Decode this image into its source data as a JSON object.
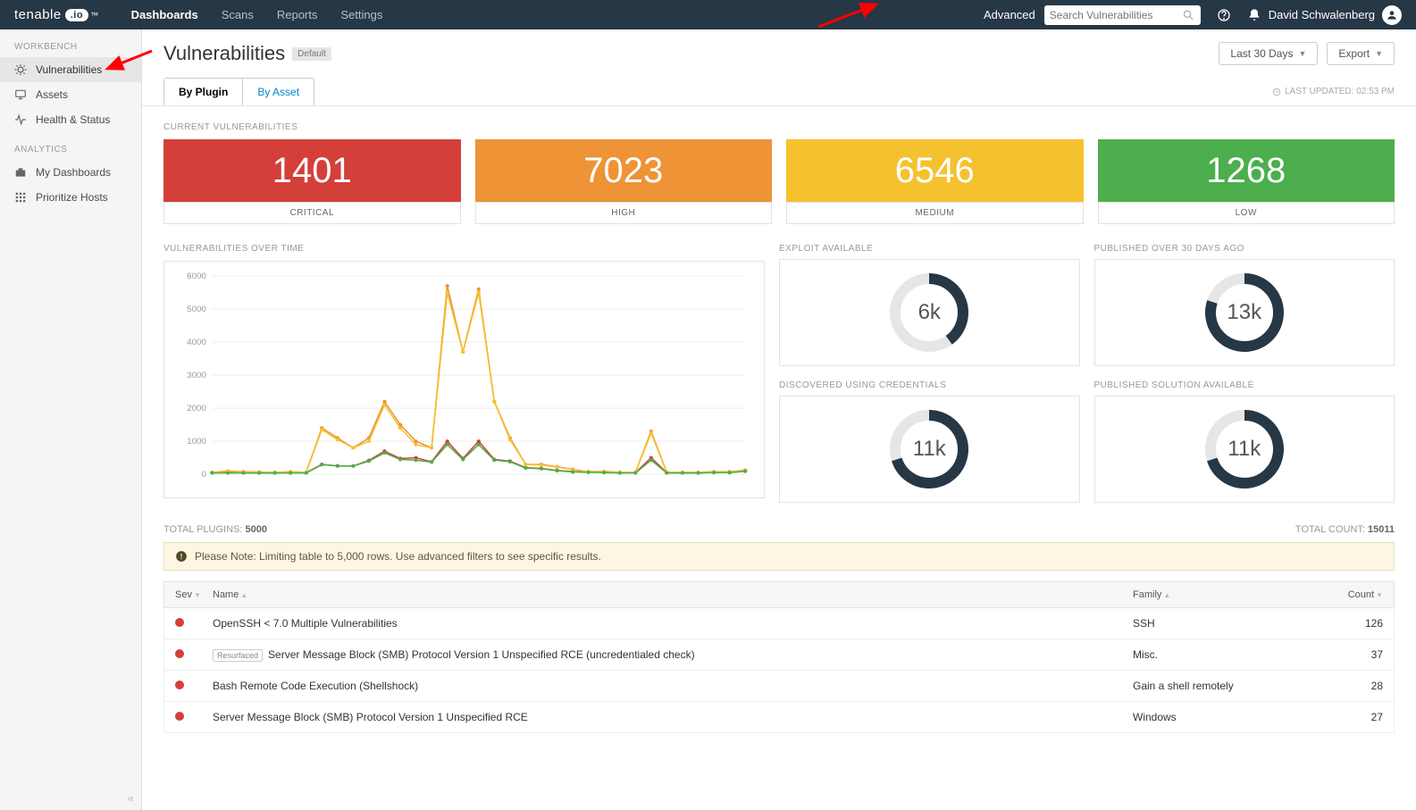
{
  "annotations": {
    "arrows": 2
  },
  "top": {
    "brand": "tenable",
    "brandIO": ".io",
    "nav": {
      "dash": "Dashboards",
      "scans": "Scans",
      "reports": "Reports",
      "settings": "Settings"
    },
    "advanced": "Advanced",
    "search_placeholder": "Search Vulnerabilities",
    "user": "David Schwalenberg"
  },
  "sidebar": {
    "workbench_hdr": "WORKBENCH",
    "items_wb": [
      {
        "label": "Vulnerabilities"
      },
      {
        "label": "Assets"
      },
      {
        "label": "Health & Status"
      }
    ],
    "analytics_hdr": "ANALYTICS",
    "items_an": [
      {
        "label": "My Dashboards"
      },
      {
        "label": "Prioritize Hosts"
      }
    ]
  },
  "header": {
    "title": "Vulnerabilities",
    "badge": "Default",
    "range": "Last 30 Days",
    "export": "Export"
  },
  "tabs": {
    "by_plugin": "By Plugin",
    "by_asset": "By Asset",
    "last_updated": "LAST UPDATED: 02:53 PM"
  },
  "curr_vuln_hdr": "CURRENT VULNERABILITIES",
  "cards": [
    {
      "val": "1401",
      "lbl": "CRITICAL"
    },
    {
      "val": "7023",
      "lbl": "HIGH"
    },
    {
      "val": "6546",
      "lbl": "MEDIUM"
    },
    {
      "val": "1268",
      "lbl": "LOW"
    }
  ],
  "vot_hdr": "VULNERABILITIES OVER TIME",
  "chart_data": {
    "type": "line",
    "xlabel": "",
    "ylabel": "",
    "yticks": [
      0,
      1000,
      2000,
      3000,
      4000,
      5000,
      6000
    ],
    "ylim": [
      0,
      6000
    ],
    "x": [
      0,
      1,
      2,
      3,
      4,
      5,
      6,
      7,
      8,
      9,
      10,
      11,
      12,
      13,
      14,
      15,
      16,
      17,
      18,
      19,
      20,
      21,
      22,
      23,
      24,
      25,
      26,
      27,
      28,
      29,
      30,
      31,
      32,
      33,
      34
    ],
    "series": [
      {
        "name": "Critical",
        "color": "#d43f3a",
        "values": [
          50,
          50,
          50,
          40,
          40,
          50,
          50,
          300,
          250,
          250,
          420,
          700,
          480,
          500,
          380,
          1000,
          480,
          1000,
          450,
          400,
          200,
          180,
          120,
          80,
          70,
          60,
          50,
          50,
          500,
          50,
          40,
          40,
          60,
          50,
          100
        ]
      },
      {
        "name": "High",
        "color": "#ee9336",
        "values": [
          60,
          100,
          80,
          70,
          60,
          80,
          60,
          1400,
          1100,
          800,
          1100,
          2200,
          1500,
          1000,
          800,
          5700,
          3700,
          5600,
          2200,
          1100,
          300,
          300,
          230,
          150,
          80,
          90,
          60,
          60,
          1300,
          60,
          60,
          60,
          80,
          80,
          130
        ]
      },
      {
        "name": "Medium",
        "color": "#f5c12e",
        "values": [
          60,
          100,
          70,
          70,
          60,
          70,
          60,
          1350,
          1050,
          800,
          1000,
          2100,
          1400,
          900,
          800,
          5500,
          3700,
          5500,
          2200,
          1050,
          300,
          280,
          220,
          140,
          80,
          80,
          60,
          60,
          1250,
          60,
          60,
          60,
          70,
          80,
          120
        ]
      },
      {
        "name": "Low",
        "color": "#4cae4c",
        "values": [
          40,
          40,
          40,
          40,
          40,
          40,
          40,
          290,
          260,
          250,
          400,
          650,
          450,
          430,
          370,
          900,
          450,
          900,
          430,
          380,
          190,
          170,
          110,
          70,
          60,
          50,
          40,
          40,
          430,
          40,
          40,
          40,
          50,
          50,
          90
        ]
      }
    ]
  },
  "donuts": [
    {
      "title": "EXPLOIT AVAILABLE",
      "val": "6k",
      "pct": 40
    },
    {
      "title": "PUBLISHED OVER 30 DAYS AGO",
      "val": "13k",
      "pct": 80
    },
    {
      "title": "DISCOVERED USING CREDENTIALS",
      "val": "11k",
      "pct": 70
    },
    {
      "title": "PUBLISHED SOLUTION AVAILABLE",
      "val": "11k",
      "pct": 70
    }
  ],
  "meta": {
    "tp": "TOTAL PLUGINS:",
    "tpv": "5000",
    "tc": "TOTAL COUNT:",
    "tcv": "15011"
  },
  "notice": "Please Note: Limiting table to 5,000 rows. Use advanced filters to see specific results.",
  "thead": {
    "sev": "Sev",
    "name": "Name",
    "fam": "Family",
    "count": "Count"
  },
  "rows": [
    {
      "name": "OpenSSH < 7.0 Multiple Vulnerabilities",
      "fam": "SSH",
      "cnt": "126",
      "resurf": false
    },
    {
      "name": "Server Message Block (SMB) Protocol Version 1 Unspecified RCE (uncredentialed check)",
      "fam": "Misc.",
      "cnt": "37",
      "resurf": true
    },
    {
      "name": "Bash Remote Code Execution (Shellshock)",
      "fam": "Gain a shell remotely",
      "cnt": "28",
      "resurf": false
    },
    {
      "name": "Server Message Block (SMB) Protocol Version 1 Unspecified RCE",
      "fam": "Windows",
      "cnt": "27",
      "resurf": false
    }
  ],
  "resurf_label": "Resurfaced"
}
